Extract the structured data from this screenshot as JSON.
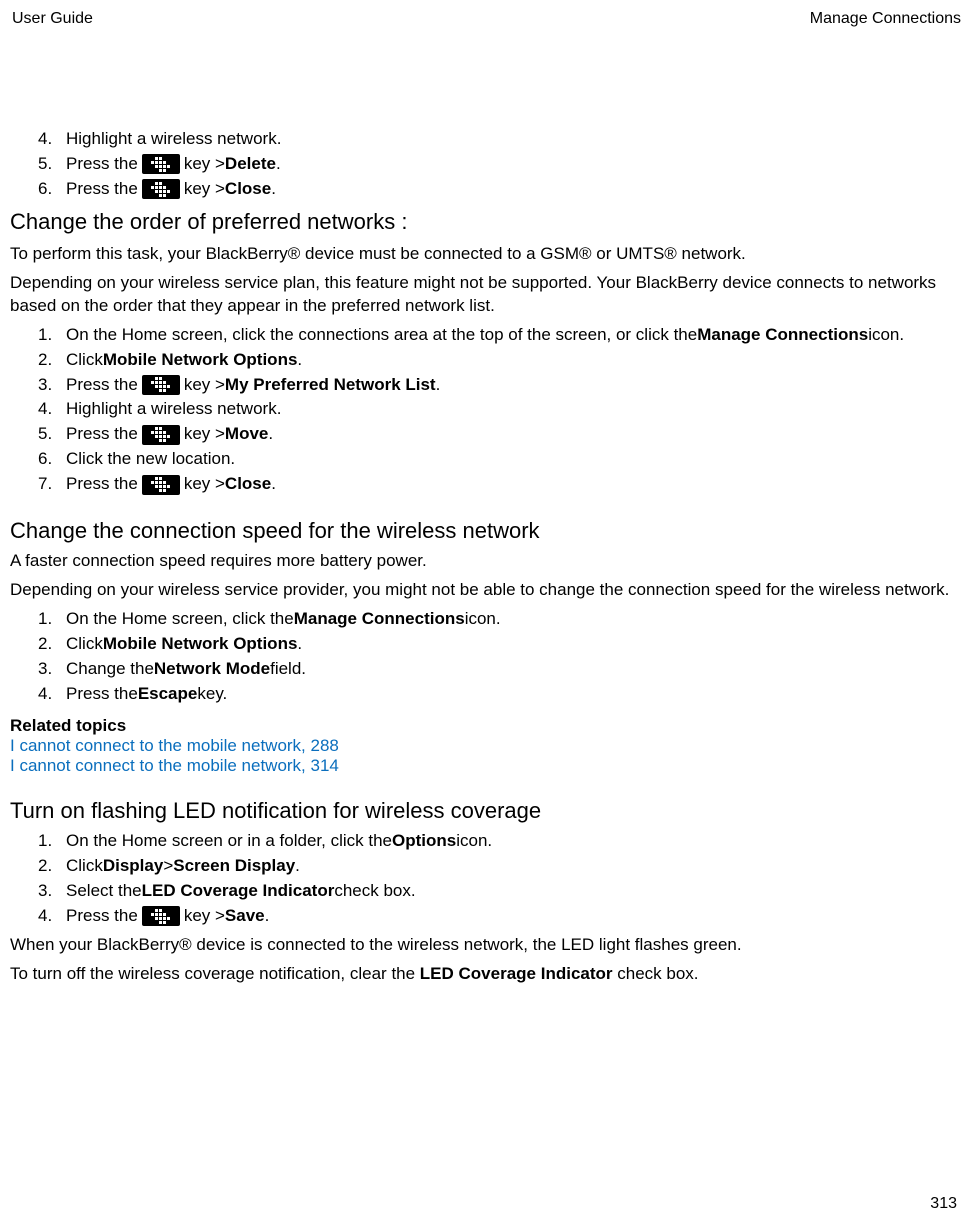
{
  "header": {
    "left": "User Guide",
    "right": "Manage Connections"
  },
  "topList": {
    "items": [
      {
        "num": "4.",
        "type": "text",
        "text": "Highlight a wireless network."
      },
      {
        "num": "5.",
        "type": "key",
        "prefix": "Press the ",
        "suffix": " key > ",
        "action": "Delete",
        "end": "."
      },
      {
        "num": "6.",
        "type": "key",
        "prefix": "Press the ",
        "suffix": " key > ",
        "action": "Close",
        "end": "."
      }
    ]
  },
  "section1": {
    "title": "Change the order of preferred networks :",
    "para1": "To perform this task, your BlackBerry® device must be connected to a GSM® or UMTS® network.",
    "para2": "Depending on your wireless service plan, this feature might not be supported. Your BlackBerry device connects to networks based on the order that they appear in the preferred network list.",
    "items": [
      {
        "num": "1.",
        "type": "rich",
        "parts": [
          "On the Home screen, click the connections area at the top of the screen, or click the ",
          {
            "b": "Manage Connections"
          },
          " icon."
        ]
      },
      {
        "num": "2.",
        "type": "rich",
        "parts": [
          "Click ",
          {
            "b": "Mobile Network Options"
          },
          "."
        ]
      },
      {
        "num": "3.",
        "type": "key",
        "prefix": "Press the ",
        "suffix": " key > ",
        "action": "My Preferred Network List",
        "end": "."
      },
      {
        "num": "4.",
        "type": "text",
        "text": "Highlight a wireless network."
      },
      {
        "num": "5.",
        "type": "key",
        "prefix": "Press the ",
        "suffix": " key > ",
        "action": "Move",
        "end": "."
      },
      {
        "num": "6.",
        "type": "text",
        "text": "Click the new location."
      },
      {
        "num": "7.",
        "type": "key",
        "prefix": "Press the ",
        "suffix": " key > ",
        "action": "Close",
        "end": "."
      }
    ]
  },
  "section2": {
    "title": "Change the connection speed for the wireless network",
    "para1": "A faster connection speed requires more battery power.",
    "para2": "Depending on your wireless service provider, you might not be able to change the connection speed for the wireless network.",
    "items": [
      {
        "num": "1.",
        "type": "rich",
        "parts": [
          "On the Home screen, click the ",
          {
            "b": "Manage Connections"
          },
          " icon."
        ]
      },
      {
        "num": "2.",
        "type": "rich",
        "parts": [
          "Click ",
          {
            "b": "Mobile Network Options"
          },
          "."
        ]
      },
      {
        "num": "3.",
        "type": "rich",
        "parts": [
          "Change the ",
          {
            "b": "Network Mode"
          },
          " field."
        ]
      },
      {
        "num": "4.",
        "type": "rich",
        "parts": [
          "Press the ",
          {
            "b": "Escape"
          },
          " key."
        ]
      }
    ],
    "relatedTitle": "Related topics",
    "links": [
      "I cannot connect to the mobile network, 288",
      "I cannot connect to the mobile network, 314"
    ]
  },
  "section3": {
    "title": "Turn on flashing LED notification for wireless coverage",
    "items": [
      {
        "num": "1.",
        "type": "rich",
        "parts": [
          "On the Home screen or in a folder, click the ",
          {
            "b": "Options"
          },
          " icon."
        ]
      },
      {
        "num": "2.",
        "type": "rich",
        "parts": [
          "Click ",
          {
            "b": "Display"
          },
          " > ",
          {
            "b": "Screen Display"
          },
          "."
        ]
      },
      {
        "num": "3.",
        "type": "rich",
        "parts": [
          "Select the ",
          {
            "b": "LED Coverage Indicator"
          },
          " check box."
        ]
      },
      {
        "num": "4.",
        "type": "key",
        "prefix": "Press the ",
        "suffix": " key > ",
        "action": "Save",
        "end": "."
      }
    ],
    "para1": "When your BlackBerry® device is connected to the wireless network, the LED light flashes green.",
    "para2a": "To turn off the wireless coverage notification, clear the ",
    "para2b": "LED Coverage Indicator",
    "para2c": " check box."
  },
  "pageNumber": "313"
}
